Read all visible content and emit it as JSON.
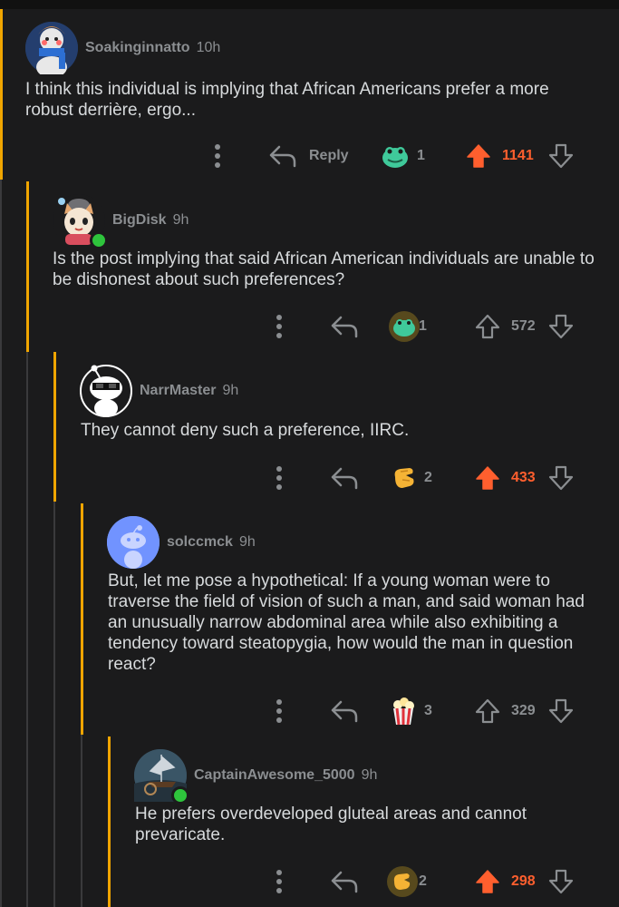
{
  "colors": {
    "upvote_active": "#ff5f2e",
    "thread_line": "#f0a500",
    "muted": "#8b8e91",
    "background": "#1b1b1c"
  },
  "comments": [
    {
      "username": "Soakinginnatto",
      "time": "10h",
      "body": "I think this individual is implying that African Americans prefer a more robust derrière, ergo...",
      "reply_label": "Reply",
      "award_count": "1",
      "score": "1141",
      "upvoted": true,
      "award_icon": "frog-award-icon"
    },
    {
      "username": "BigDisk",
      "time": "9h",
      "body": "Is the post implying that said African American individuals are unable to be dishonest about such preferences?",
      "award_count": "1",
      "score": "572",
      "upvoted": false,
      "online": true,
      "award_icon": "glowing-frog-award-icon"
    },
    {
      "username": "NarrMaster",
      "time": "9h",
      "body": "They cannot deny such a preference, IIRC.",
      "award_count": "2",
      "score": "433",
      "upvoted": true,
      "award_icon": "hand-award-icon"
    },
    {
      "username": "solccmck",
      "time": "9h",
      "body": "But, let me pose a hypothetical: If a young woman were to traverse the field of vision of such a man, and said woman had an unusually narrow abdominal area while also exhibiting a tendency toward steatopygia, how would the man in question react?",
      "award_count": "3",
      "score": "329",
      "upvoted": false,
      "award_icon": "popcorn-award-icon"
    },
    {
      "username": "CaptainAwesome_5000",
      "time": "9h",
      "body": "He prefers overdeveloped gluteal areas and cannot prevaricate.",
      "award_count": "2",
      "score": "298",
      "upvoted": true,
      "online": true,
      "award_icon": "glowing-hand-award-icon"
    }
  ]
}
